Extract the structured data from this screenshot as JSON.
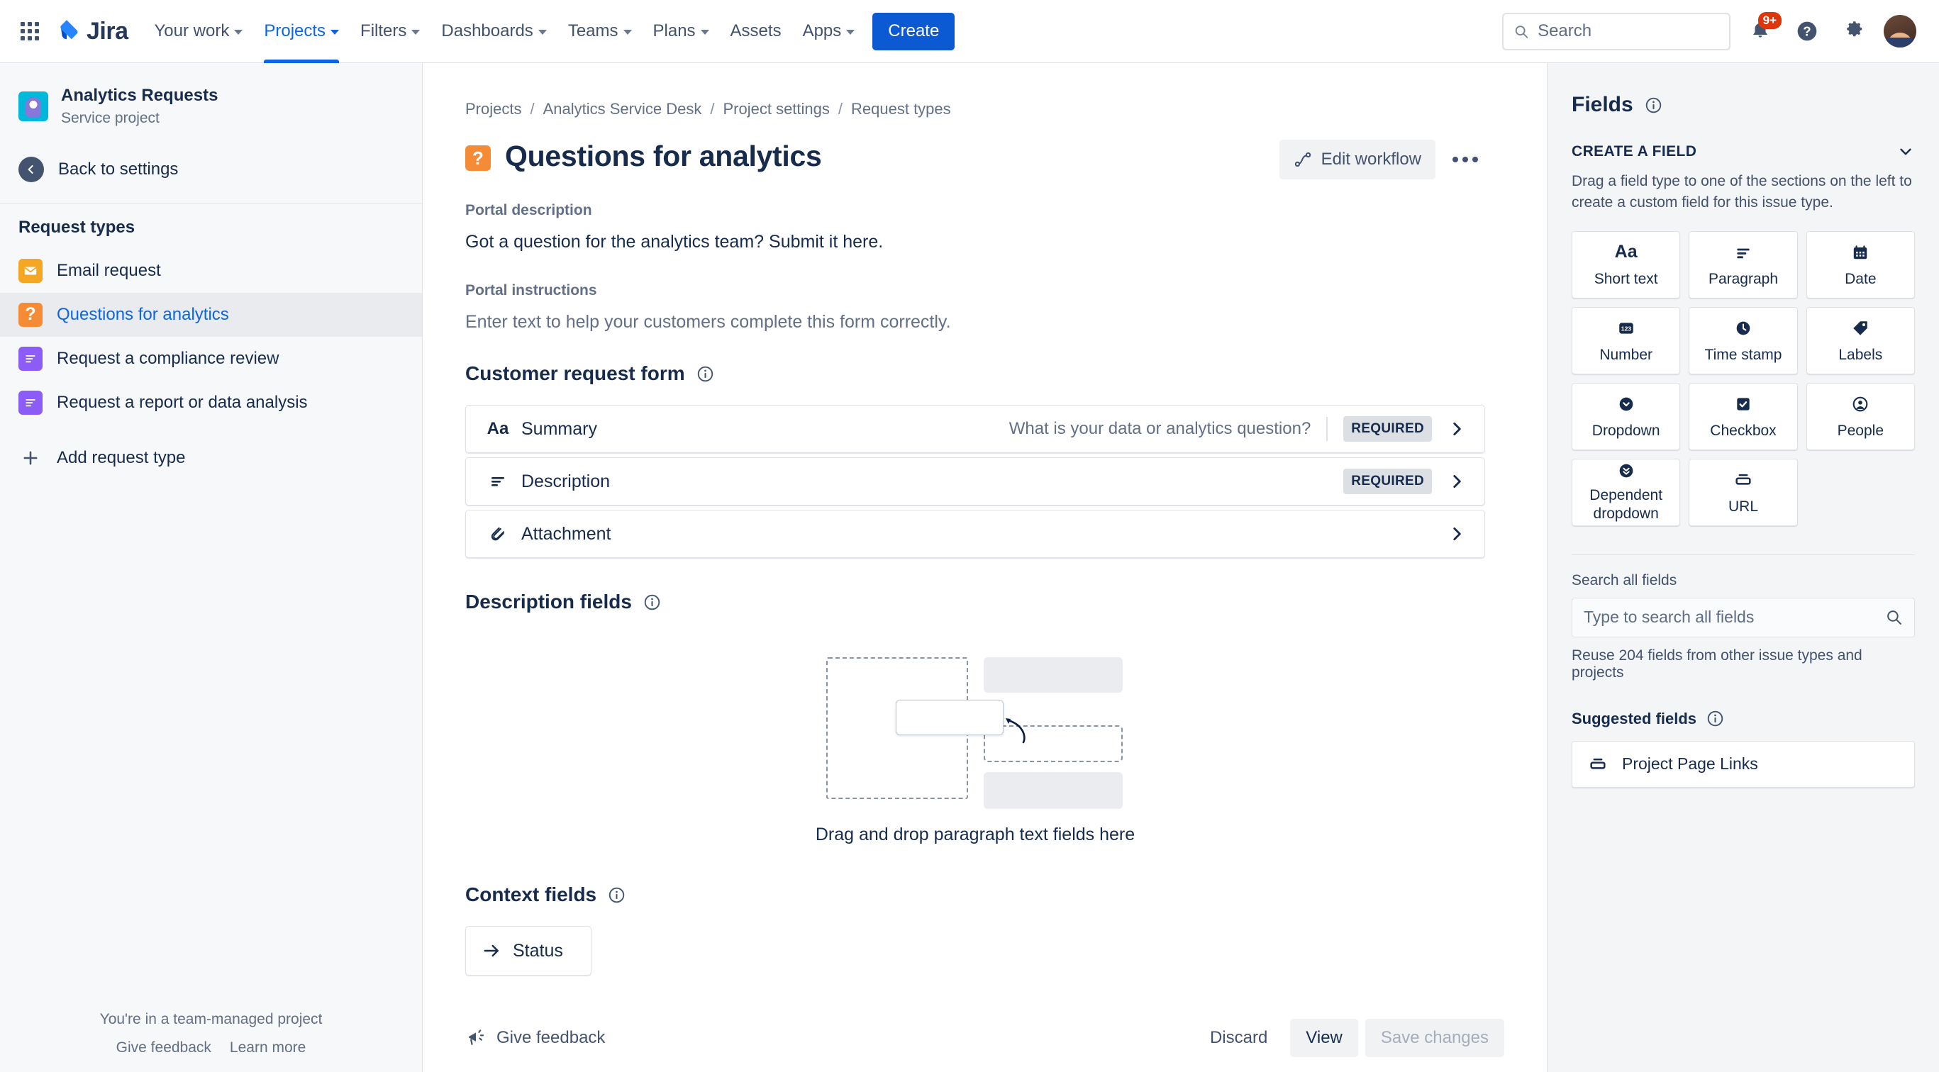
{
  "topnav": {
    "brand": "Jira",
    "items": [
      {
        "label": "Your work",
        "has_chevron": true,
        "active": false
      },
      {
        "label": "Projects",
        "has_chevron": true,
        "active": true
      },
      {
        "label": "Filters",
        "has_chevron": true,
        "active": false
      },
      {
        "label": "Dashboards",
        "has_chevron": true,
        "active": false
      },
      {
        "label": "Teams",
        "has_chevron": true,
        "active": false
      },
      {
        "label": "Plans",
        "has_chevron": true,
        "active": false
      },
      {
        "label": "Assets",
        "has_chevron": false,
        "active": false
      },
      {
        "label": "Apps",
        "has_chevron": true,
        "active": false
      }
    ],
    "create_label": "Create",
    "search_placeholder": "Search",
    "search_value": "",
    "notification_badge": "9+",
    "icons": [
      "app-switcher-icon",
      "search-icon",
      "notifications-icon",
      "help-icon",
      "settings-icon",
      "avatar"
    ]
  },
  "sidebar": {
    "project_name": "Analytics Requests",
    "project_type": "Service project",
    "back_label": "Back to settings",
    "section_heading": "Request types",
    "request_types": [
      {
        "label": "Email request",
        "icon": "email-icon",
        "icon_kind": "orange",
        "selected": false
      },
      {
        "label": "Questions for analytics",
        "icon": "question-icon",
        "icon_kind": "qmark",
        "selected": true
      },
      {
        "label": "Request a compliance review",
        "icon": "paragraph-icon",
        "icon_kind": "purple",
        "selected": false
      },
      {
        "label": "Request a report or data analysis",
        "icon": "paragraph-icon",
        "icon_kind": "purple",
        "selected": false
      }
    ],
    "add_request_type": "Add request type",
    "footer_note": "You're in a team-managed project",
    "footer_links": [
      "Give feedback",
      "Learn more"
    ]
  },
  "main": {
    "breadcrumbs": [
      "Projects",
      "Analytics Service Desk",
      "Project settings",
      "Request types"
    ],
    "breadcrumb_separator": "/",
    "page_title": "Questions for analytics",
    "title_icon": "question-icon",
    "edit_workflow_label": "Edit workflow",
    "more_label": "more-actions",
    "portal_description_label": "Portal description",
    "portal_description_value": "Got a question for the analytics team? Submit it here.",
    "portal_instructions_label": "Portal instructions",
    "portal_instructions_value": "Enter text to help your customers complete this form correctly.",
    "customer_request_form": {
      "title": "Customer request form",
      "rows": [
        {
          "name": "Summary",
          "icon": "short-text-icon",
          "hint": "What is your data or analytics question?",
          "badge": "REQUIRED"
        },
        {
          "name": "Description",
          "icon": "paragraph-icon",
          "hint": "",
          "badge": "REQUIRED"
        },
        {
          "name": "Attachment",
          "icon": "attachment-icon",
          "hint": "",
          "badge": ""
        }
      ]
    },
    "description_fields": {
      "title": "Description fields",
      "empty_text": "Drag and drop paragraph text fields here"
    },
    "context_fields": {
      "title": "Context fields",
      "items": [
        {
          "label": "Status",
          "icon": "arrow-right-icon"
        }
      ]
    },
    "footer": {
      "give_feedback": "Give feedback",
      "discard": "Discard",
      "view": "View",
      "save_changes": "Save changes"
    }
  },
  "right_panel": {
    "title": "Fields",
    "create_field_label": "CREATE A FIELD",
    "create_field_desc": "Drag a field type to one of the sections on the left to create a custom field for this issue type.",
    "field_types": [
      {
        "label": "Short text",
        "icon": "short-text-icon"
      },
      {
        "label": "Paragraph",
        "icon": "paragraph-icon"
      },
      {
        "label": "Date",
        "icon": "calendar-icon"
      },
      {
        "label": "Number",
        "icon": "number-icon"
      },
      {
        "label": "Time stamp",
        "icon": "clock-icon"
      },
      {
        "label": "Labels",
        "icon": "label-tag-icon"
      },
      {
        "label": "Dropdown",
        "icon": "chevron-down-circle-icon"
      },
      {
        "label": "Checkbox",
        "icon": "checkbox-icon"
      },
      {
        "label": "People",
        "icon": "person-icon"
      },
      {
        "label": "Dependent dropdown",
        "icon": "double-chevron-down-circle-icon"
      },
      {
        "label": "URL",
        "icon": "url-icon"
      }
    ],
    "search_all_label": "Search all fields",
    "search_all_placeholder": "Type to search all fields",
    "search_all_value": "",
    "reuse_text": "Reuse 204 fields from other issue types and projects",
    "suggested_label": "Suggested fields",
    "suggested_fields": [
      {
        "label": "Project Page Links",
        "icon": "url-icon"
      }
    ]
  },
  "colors": {
    "brand_blue": "#0C66E4",
    "create_button": "#0C5AD3",
    "badge_red": "#DE350B",
    "orange_icon": "#F58B35",
    "purple_icon": "#8B5CF6",
    "text_primary": "#172B4D",
    "text_subtle": "#626F86"
  }
}
